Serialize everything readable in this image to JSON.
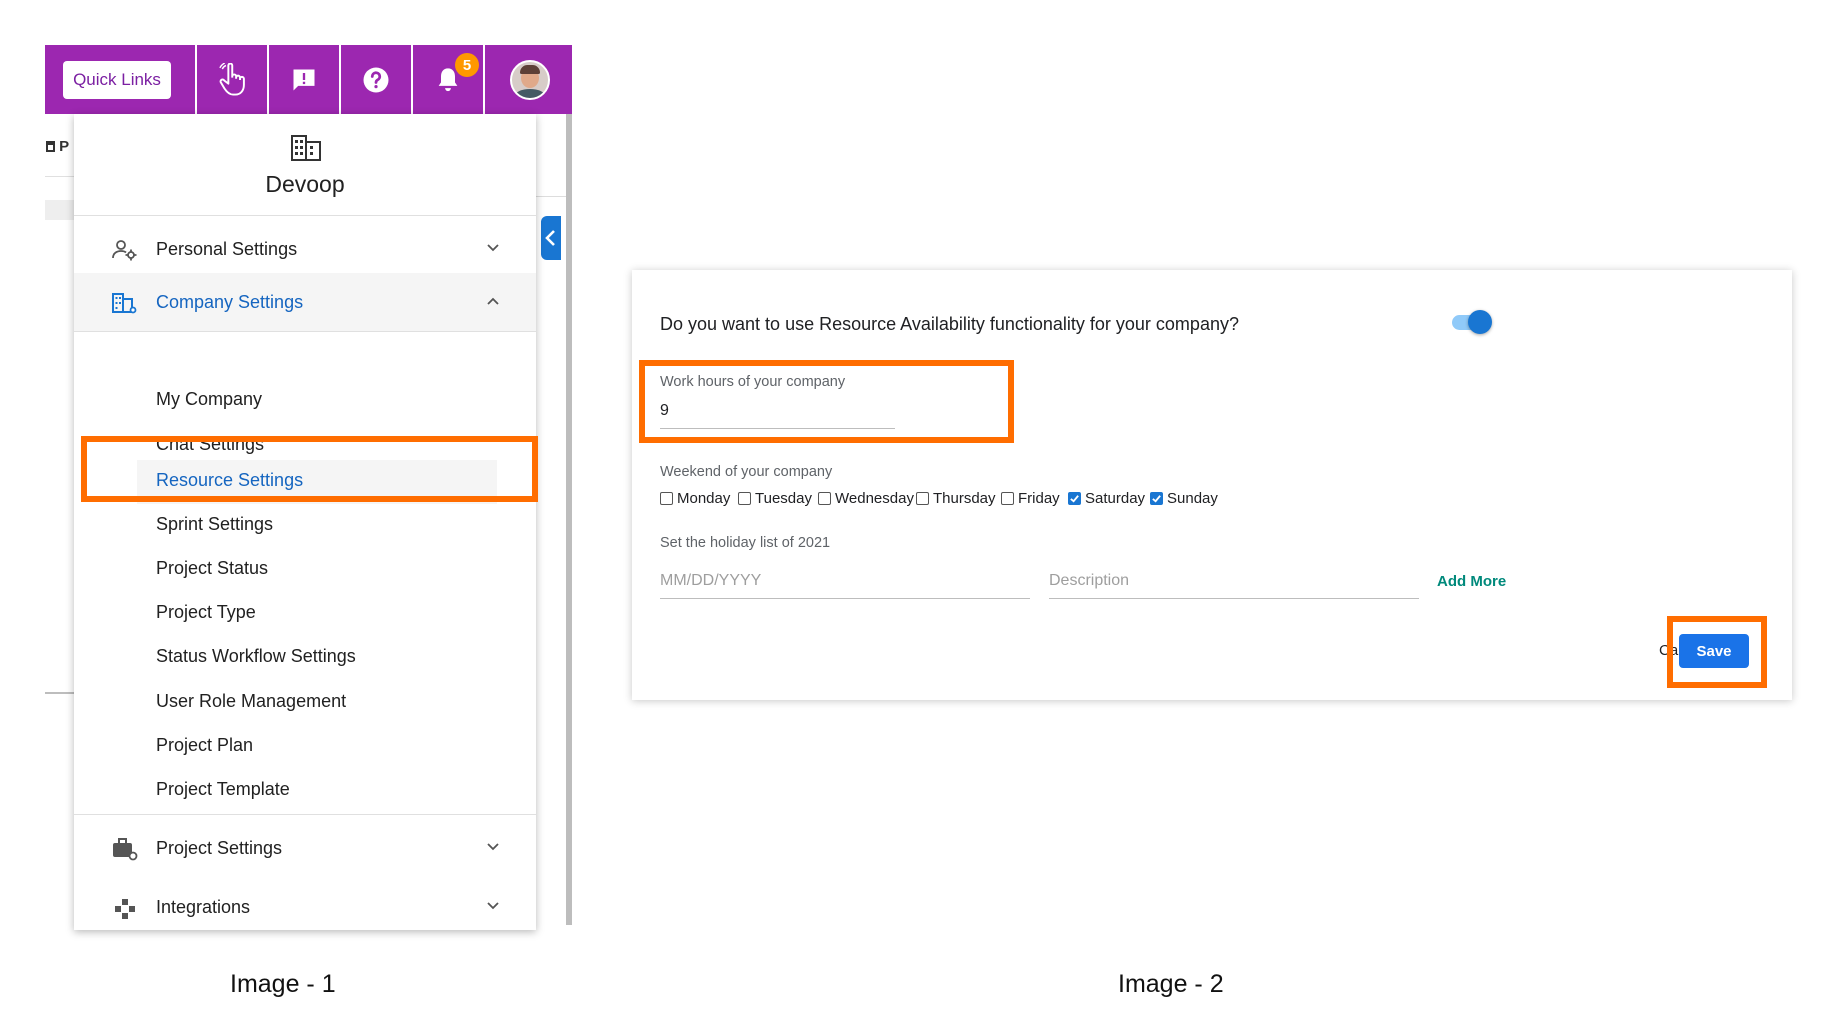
{
  "topbar": {
    "quick_links_label": "Quick Links",
    "notification_count": "5",
    "partial_tab_label": "P"
  },
  "menu": {
    "company_name": "Devoop",
    "sections": {
      "personal": "Personal Settings",
      "company": "Company Settings",
      "project": "Project Settings",
      "integrations": "Integrations"
    },
    "company_items": [
      "My Company",
      "Chat Settings",
      "Resource Settings",
      "Sprint Settings",
      "Project Status",
      "Project Type",
      "Status Workflow Settings",
      "User Role Management",
      "Project Plan",
      "Project Template"
    ]
  },
  "captions": {
    "image1": "Image - 1",
    "image2": "Image - 2"
  },
  "resource_form": {
    "question": "Do you want to use Resource Availability functionality for your company?",
    "toggle_on": true,
    "work_hours_label": "Work hours of your company",
    "work_hours_value": "9",
    "weekend_label": "Weekend of your company",
    "days": [
      {
        "label": "Monday",
        "checked": false
      },
      {
        "label": "Tuesday",
        "checked": false
      },
      {
        "label": "Wednesday",
        "checked": false
      },
      {
        "label": "Thursday",
        "checked": false
      },
      {
        "label": "Friday",
        "checked": false
      },
      {
        "label": "Saturday",
        "checked": true
      },
      {
        "label": "Sunday",
        "checked": true
      }
    ],
    "holiday_label": "Set the holiday list of 2021",
    "date_placeholder": "MM/DD/YYYY",
    "description_placeholder": "Description",
    "add_more_label": "Add More",
    "cancel_label": "Cancel",
    "save_label": "Save"
  },
  "colors": {
    "topbar": "#9c27b0",
    "highlight": "#ff6d00",
    "accent": "#1976d2",
    "badge": "#ff9800",
    "add_more": "#00897b"
  }
}
